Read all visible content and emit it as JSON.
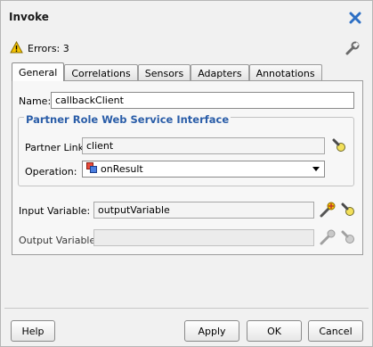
{
  "dialog": {
    "title": "Invoke",
    "errors_text": "Errors: 3"
  },
  "tabs": [
    {
      "label": "General",
      "active": true
    },
    {
      "label": "Correlations",
      "active": false
    },
    {
      "label": "Sensors",
      "active": false
    },
    {
      "label": "Adapters",
      "active": false
    },
    {
      "label": "Annotations",
      "active": false
    }
  ],
  "general": {
    "name_label": "Name:",
    "name_value": "callbackClient",
    "group_title": "Partner Role Web Service Interface",
    "partner_link_label": "Partner Link:",
    "partner_link_value": "client",
    "operation_label": "Operation:",
    "operation_value": "onResult",
    "input_variable_label": "Input Variable:",
    "input_variable_value": "outputVariable",
    "output_variable_label": "Output Variable:",
    "output_variable_value": ""
  },
  "buttons": {
    "help": "Help",
    "apply": "Apply",
    "ok": "OK",
    "cancel": "Cancel"
  },
  "colors": {
    "group_title": "#2a5da8",
    "close_icon": "#2d6fc4",
    "warning": "#f5c400"
  },
  "icons": [
    "close-icon",
    "warning-icon",
    "wrench-icon",
    "flashlight-icon",
    "operation-icon",
    "create-variable-icon"
  ]
}
